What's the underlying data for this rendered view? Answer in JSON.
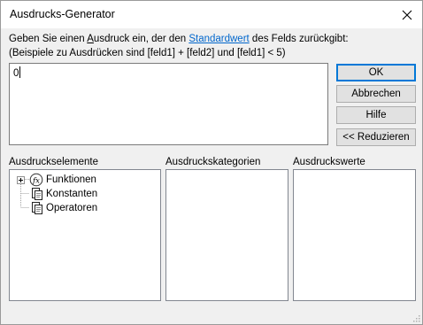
{
  "window": {
    "title": "Ausdrucks-Generator"
  },
  "instructions": {
    "line1_before_u": "Geben Sie einen ",
    "line1_u": "A",
    "line1_after_u": "usdruck ein, der den ",
    "line1_link": "Standardwert",
    "line1_end": " des Felds zurückgibt:",
    "line2": "(Beispiele zu Ausdrücken sind [feld1] + [feld2] und [feld1] < 5)"
  },
  "expression": {
    "value": "0"
  },
  "buttons": {
    "ok": "OK",
    "cancel": "Abbrechen",
    "help": "Hilfe",
    "reduce": "<< Reduzieren"
  },
  "panels": {
    "elements_label": "Ausdruckselemente",
    "categories_label": "Ausdruckskategorien",
    "values_label": "Ausdruckswerte"
  },
  "tree": {
    "items": [
      {
        "label": "Funktionen",
        "icon": "function-fx-icon",
        "expander": "plus"
      },
      {
        "label": "Konstanten",
        "icon": "folder-icon",
        "expander": "none"
      },
      {
        "label": "Operatoren",
        "icon": "folder-icon",
        "expander": "none"
      }
    ]
  },
  "colors": {
    "link": "#0066cc",
    "default_button_border": "#0078d7",
    "dialog_bg": "#f0f0f0"
  }
}
